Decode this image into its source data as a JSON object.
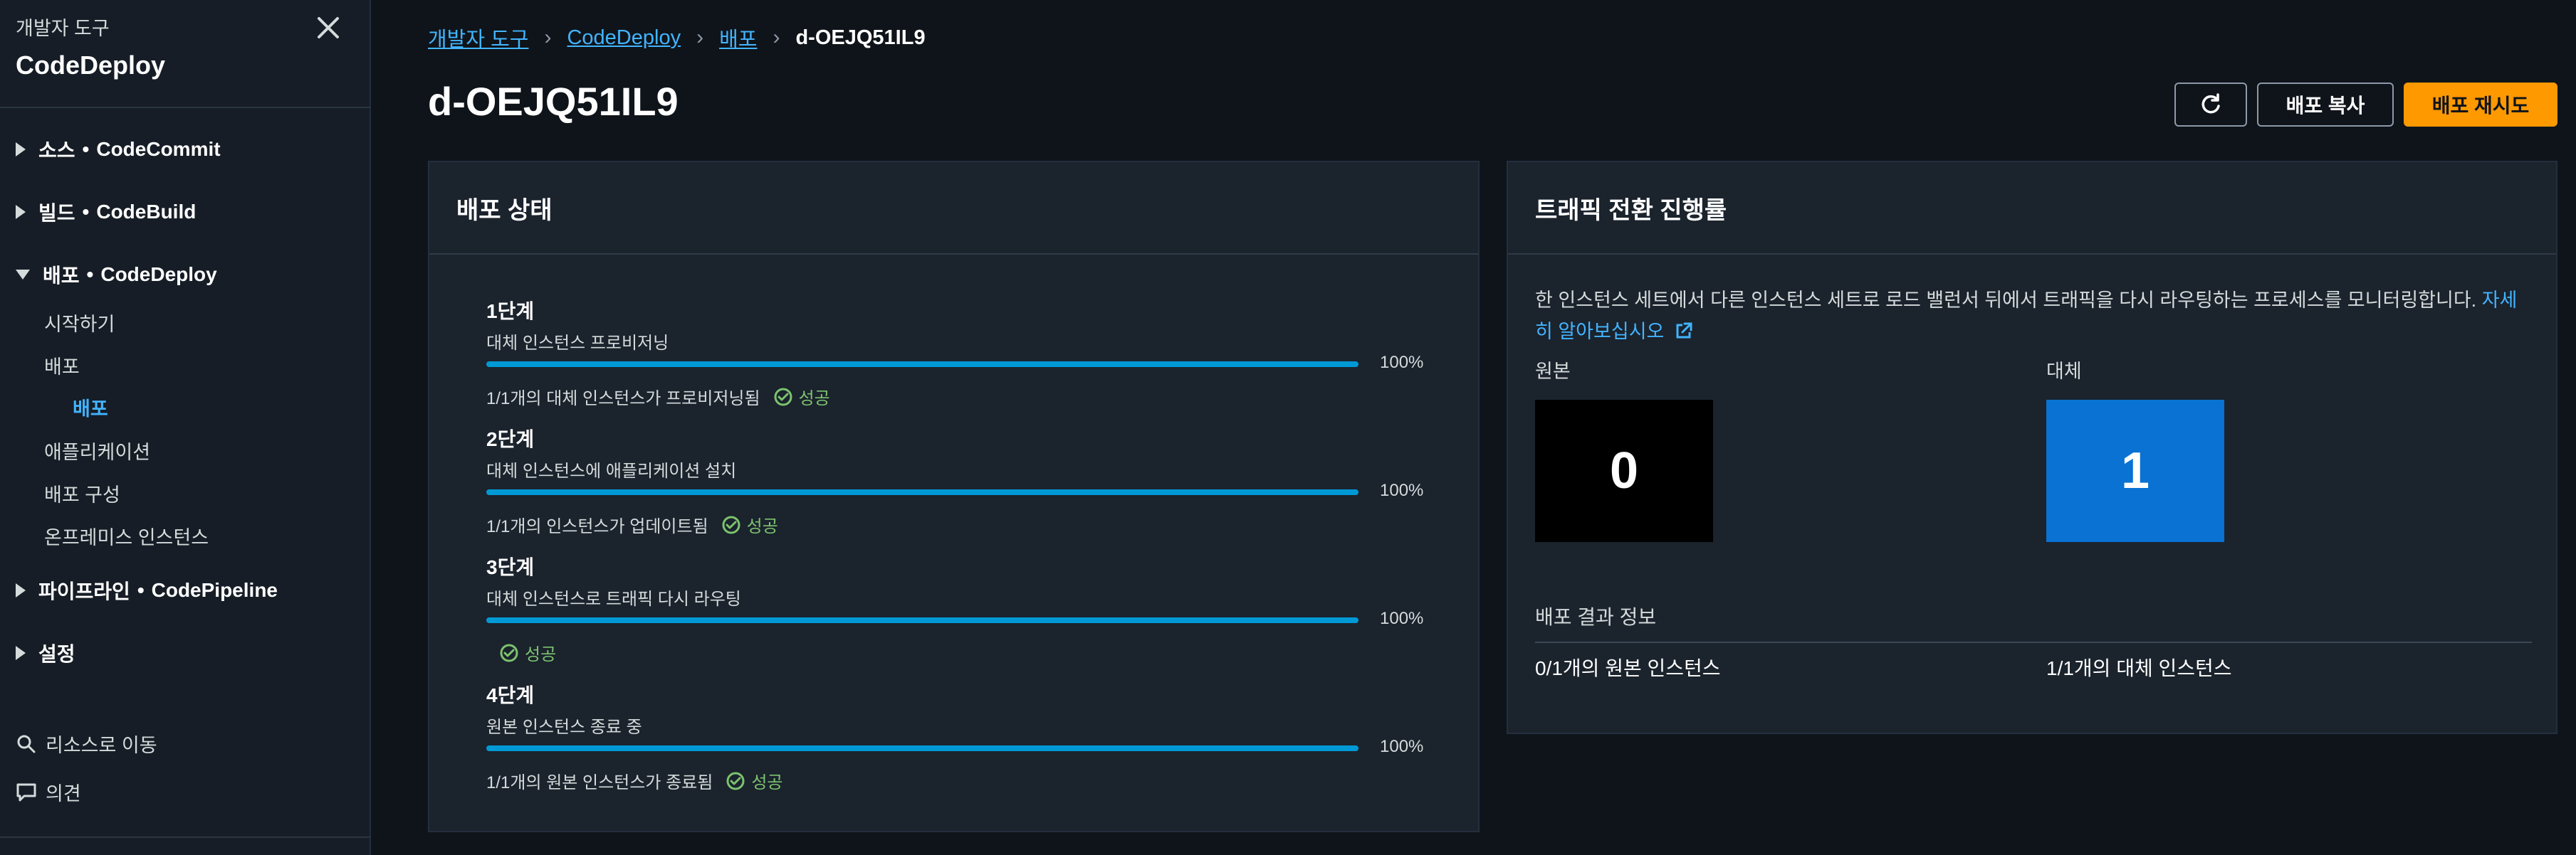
{
  "sidebar": {
    "parent": "개발자 도구",
    "title": "CodeDeploy",
    "sections": [
      {
        "label": "소스",
        "service": "CodeCommit"
      },
      {
        "label": "빌드",
        "service": "CodeBuild"
      },
      {
        "label": "배포",
        "service": "CodeDeploy"
      },
      {
        "label": "파이프라인",
        "service": "CodePipeline"
      },
      {
        "label": "설정",
        "service": ""
      }
    ],
    "bullet": "•",
    "deploy_items": [
      "시작하기",
      "배포",
      "배포",
      "애플리케이션",
      "배포 구성",
      "온프레미스 인스턴스"
    ],
    "utils": {
      "go_to_resource": "리소스로 이동",
      "feedback": "의견"
    }
  },
  "breadcrumb": [
    "개발자 도구",
    "CodeDeploy",
    "배포",
    "d-OEJQ51IL9"
  ],
  "page_title": "d-OEJQ51IL9",
  "buttons": {
    "copy": "배포 복사",
    "retry": "배포 재시도"
  },
  "status_card": {
    "title": "배포 상태",
    "success_label": "성공",
    "steps": [
      {
        "name": "1단계",
        "desc": "대체 인스턴스 프로비저닝",
        "progress": 100,
        "pct_label": "100%",
        "status": "1/1개의 대체 인스턴스가 프로비저닝됨"
      },
      {
        "name": "2단계",
        "desc": "대체 인스턴스에 애플리케이션 설치",
        "progress": 100,
        "pct_label": "100%",
        "status": "1/1개의 인스턴스가 업데이트됨"
      },
      {
        "name": "3단계",
        "desc": "대체 인스턴스로 트래픽 다시 라우팅",
        "progress": 100,
        "pct_label": "100%",
        "status": ""
      },
      {
        "name": "4단계",
        "desc": "원본 인스턴스 종료 중",
        "progress": 100,
        "pct_label": "100%",
        "status": "1/1개의 원본 인스턴스가 종료됨"
      }
    ]
  },
  "traffic_card": {
    "title": "트래픽 전환 진행률",
    "description": "한 인스턴스 세트에서 다른 인스턴스 세트로 로드 밸런서 뒤에서 트래픽을 다시 라우팅하는 프로세스를 모니터링합니다.",
    "link_text": "자세히 알아보십시오",
    "original_label": "원본",
    "original_value": "0",
    "replacement_label": "대체",
    "replacement_value": "1",
    "result_title": "배포 결과 정보",
    "original_result": "0/1개의 원본 인스턴스",
    "replacement_result": "1/1개의 대체 인스턴스"
  },
  "colors": {
    "accent": "#ff9900",
    "link": "#42b4ff",
    "progress": "#0099d6",
    "success": "#7cc36e",
    "replacement_box": "#0972d3",
    "original_box": "#000000"
  }
}
